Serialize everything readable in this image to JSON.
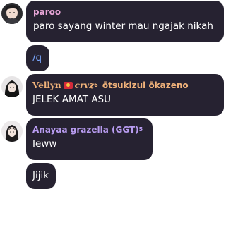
{
  "messages": [
    {
      "sender": "paroo",
      "sender_color": "#e8a6d8",
      "text": "paro sayang winter mau ngajak nikah",
      "has_avatar": true
    },
    {
      "text": "/q",
      "text_color": "#7aa8ff",
      "continuation": true
    },
    {
      "sender_name_a": "Vellyn",
      "sender_name_b": "crvz",
      "sender_sup": "6",
      "sender_extra": "ōtsukizui ōkazeno",
      "sender_color": "#f0b27a",
      "text": "JELEK AMAT ASU",
      "has_avatar": true
    },
    {
      "sender": "Anayaa grazella (GGT)",
      "sender_sup": "5",
      "sender_color": "#b89cf0",
      "text": "Ieww",
      "has_avatar": true
    },
    {
      "text": "Jijik",
      "continuation": true
    }
  ],
  "colors": {
    "bubble": "#262231",
    "background": "#ffffff"
  }
}
